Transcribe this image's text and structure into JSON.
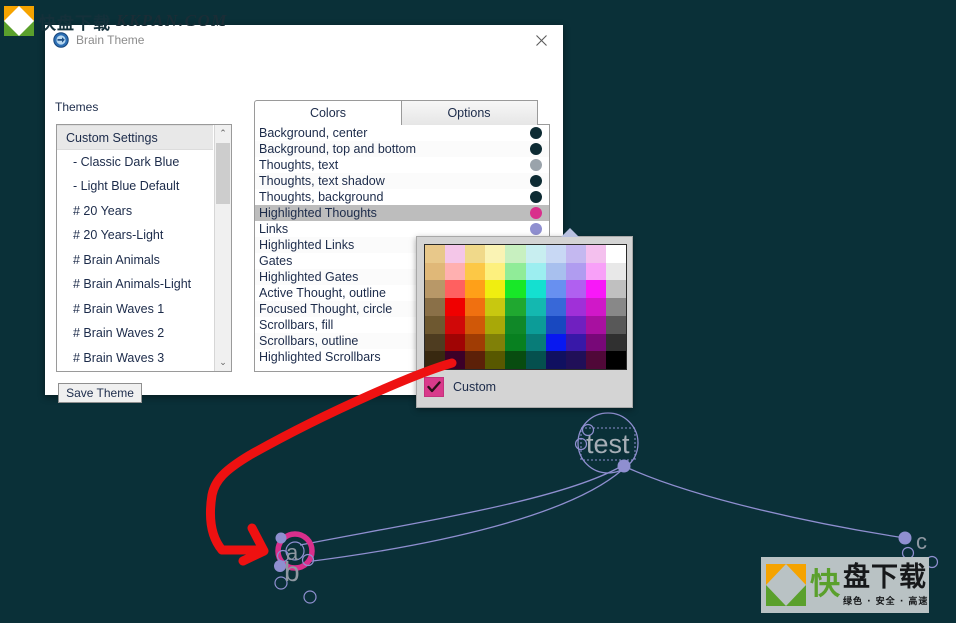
{
  "window": {
    "title": "Brain Theme",
    "icon": "brain-theme-icon",
    "close_icon": "close-icon"
  },
  "themes_panel": {
    "label": "Themes",
    "items": [
      {
        "label": "Custom Settings",
        "selected": true,
        "indent": false
      },
      {
        "label": "- Classic Dark Blue",
        "selected": false,
        "indent": true
      },
      {
        "label": "- Light Blue Default",
        "selected": false,
        "indent": true
      },
      {
        "label": "# 20 Years",
        "selected": false,
        "indent": true
      },
      {
        "label": "# 20 Years-Light",
        "selected": false,
        "indent": true
      },
      {
        "label": "# Brain Animals",
        "selected": false,
        "indent": true
      },
      {
        "label": "# Brain Animals-Light",
        "selected": false,
        "indent": true
      },
      {
        "label": "# Brain Waves 1",
        "selected": false,
        "indent": true
      },
      {
        "label": "# Brain Waves 2",
        "selected": false,
        "indent": true
      },
      {
        "label": "# Brain Waves 3",
        "selected": false,
        "indent": true
      }
    ],
    "scrollbar": {
      "up_arrow": "⌃",
      "down_arrow": "⌄"
    },
    "save_button": "Save Theme"
  },
  "tabs": [
    {
      "label": "Colors",
      "active": true
    },
    {
      "label": "Options",
      "active": false
    }
  ],
  "colors_list": [
    {
      "label": "Background, center",
      "swatch": "#0d2b33",
      "selected": false
    },
    {
      "label": "Background, top and bottom",
      "swatch": "#0d2b33",
      "selected": false
    },
    {
      "label": "Thoughts, text",
      "swatch": "#9aa3ab",
      "selected": false
    },
    {
      "label": "Thoughts, text shadow",
      "swatch": "#0d2b33",
      "selected": false
    },
    {
      "label": "Thoughts, background",
      "swatch": "#0d2b33",
      "selected": false
    },
    {
      "label": "Highlighted Thoughts",
      "swatch": "#d92f8c",
      "selected": true
    },
    {
      "label": "Links",
      "swatch": "#8f8fd0",
      "selected": false
    },
    {
      "label": "Highlighted Links",
      "swatch": "#8f8fd0",
      "selected": false
    },
    {
      "label": "Gates",
      "swatch": "#8f8fd0",
      "selected": false
    },
    {
      "label": "Highlighted Gates",
      "swatch": "#8f8fd0",
      "selected": false
    },
    {
      "label": "Active Thought, outline",
      "swatch": "#8f8fd0",
      "selected": false
    },
    {
      "label": "Focused Thought, circle",
      "swatch": "#8f8fd0",
      "selected": false
    },
    {
      "label": "Scrollbars, fill",
      "swatch": "#8f8fd0",
      "selected": false
    },
    {
      "label": "Scrollbars, outline",
      "swatch": "#8f8fd0",
      "selected": false
    },
    {
      "label": "Highlighted Scrollbars",
      "swatch": "#8f8fd0",
      "selected": false
    }
  ],
  "color_picker": {
    "custom_label": "Custom",
    "custom_checked": true,
    "custom_checkbox_color": "#d93a8b",
    "palette": [
      [
        "#e8c88a",
        "#f4c6e8",
        "#f0d98a",
        "#faf3b4",
        "#c8f0c0",
        "#c8eef0",
        "#c8d8f4",
        "#c4b8f0",
        "#f4c0ee",
        "#ffffff"
      ],
      [
        "#e0b878",
        "#ffb0b0",
        "#fcc846",
        "#fdf07e",
        "#90ec98",
        "#9ceef0",
        "#a8c0ee",
        "#b09cf0",
        "#f8a0f8",
        "#e8e8e8"
      ],
      [
        "#b89868",
        "#ff6060",
        "#ffa018",
        "#f0ee10",
        "#18e828",
        "#14e0d0",
        "#6890f0",
        "#b060f0",
        "#f818f8",
        "#c0c0c0"
      ],
      [
        "#8a7048",
        "#f00000",
        "#f07010",
        "#c8c810",
        "#20a830",
        "#14b8b0",
        "#3868d8",
        "#a030d8",
        "#d018c8",
        "#888888"
      ],
      [
        "#6e5830",
        "#d00808",
        "#d05808",
        "#a8a808",
        "#108828",
        "#0c9c98",
        "#1848c0",
        "#7020c0",
        "#a810a0",
        "#585858"
      ],
      [
        "#4e3c20",
        "#a00404",
        "#a03c04",
        "#808008",
        "#088020",
        "#087c78",
        "#0818f0",
        "#3818a8",
        "#780878",
        "#303030"
      ],
      [
        "#382810",
        "#3c0028",
        "#5c2008",
        "#585800",
        "#084c10",
        "#05504e",
        "#101060",
        "#200f58",
        "#500838",
        "#000000"
      ]
    ]
  },
  "brain": {
    "nodes": [
      {
        "id": "test",
        "label": "test",
        "active": true
      },
      {
        "id": "a",
        "label": "a",
        "highlighted": true
      },
      {
        "id": "b",
        "label": "b",
        "highlighted": false
      },
      {
        "id": "c",
        "label": "c",
        "highlighted": false
      }
    ],
    "background_color": "#0a3038",
    "link_color": "#8f8fd0",
    "highlight_color": "#d92f8c",
    "text_color": "#9aa3ad"
  },
  "annotation": {
    "arrow_color": "#ee1111",
    "name": "red-arrow-annotation"
  },
  "watermarks": {
    "top": {
      "cn": "快盘下载",
      "en": "KKPAN.COM"
    },
    "bottom": {
      "cn_left": "快",
      "cn_right": "盘下载",
      "sub": "绿色 · 安全 · 高速"
    }
  }
}
